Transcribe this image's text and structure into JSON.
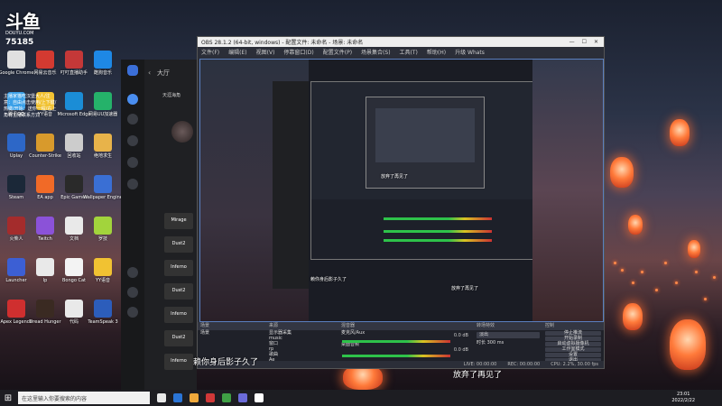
{
  "overlay": {
    "logo": "斗鱼",
    "logo_sub": "DOUYU.COM",
    "room": "75185",
    "notice": "主播家猫吃汉堡大人/注意：自由点击使用/上下键/热键/开始：送你一程/右上角有主播联系方式"
  },
  "desktop": {
    "icons": [
      {
        "label": "Google Chrome",
        "color": "#e0e0e0"
      },
      {
        "label": "网易云音乐",
        "color": "#d33a31"
      },
      {
        "label": "叮叮直播助手",
        "color": "#c43838"
      },
      {
        "label": "酷狗音乐",
        "color": "#1e88e5"
      },
      {
        "label": "腾讯QQ",
        "color": "#3aa0e8"
      },
      {
        "label": "YY语音",
        "color": "#f1c232"
      },
      {
        "label": "Microsoft Edge",
        "color": "#1b8dd6"
      },
      {
        "label": "网易UU加速器",
        "color": "#25b26a"
      },
      {
        "label": "Uplay",
        "color": "#2d67c7"
      },
      {
        "label": "Counter-Strike",
        "color": "#d89a2c"
      },
      {
        "label": "回收站",
        "color": "#cccccc"
      },
      {
        "label": "绝地求生",
        "color": "#e8b34a"
      },
      {
        "label": "Steam",
        "color": "#1b2838"
      },
      {
        "label": "EA app",
        "color": "#f16a27"
      },
      {
        "label": "Epic Games",
        "color": "#2a2a2a"
      },
      {
        "label": "Wallpaper Engine",
        "color": "#3a6fd4"
      },
      {
        "label": "火柴人",
        "color": "#a42c2c"
      },
      {
        "label": "Twitch",
        "color": "#8b52d8"
      },
      {
        "label": "文档",
        "color": "#e9e9e9"
      },
      {
        "label": "罗技",
        "color": "#a2d43c"
      },
      {
        "label": "Launcher",
        "color": "#3c5fd4"
      },
      {
        "label": "lp",
        "color": "#e9e9e9"
      },
      {
        "label": "Bongo Cat",
        "color": "#f3f3f3"
      },
      {
        "label": "YY语音",
        "color": "#f1c232"
      },
      {
        "label": "Apex Legends",
        "color": "#cf2f2f"
      },
      {
        "label": "Dread Hunger",
        "color": "#3a2a22"
      },
      {
        "label": "代码",
        "color": "#e9e9e9"
      },
      {
        "label": "TeamSpeak 3",
        "color": "#2c5dbb"
      }
    ]
  },
  "chat_app": {
    "header": "大厅",
    "lobby": "天涯海角",
    "tiles": [
      "Mirage",
      "Dust2",
      "Inferno",
      "Dust2",
      "Inferno",
      "Dust2",
      "Inferno"
    ]
  },
  "obs": {
    "title": "OBS 28.1.2 (64-bit, windows) - 配置文件: 未命名 - 场景: 未命名",
    "window_controls": [
      "—",
      "☐",
      "✕"
    ],
    "menu": [
      "文件(F)",
      "编辑(E)",
      "视图(V)",
      "停靠窗口(D)",
      "配置文件(P)",
      "场景集合(S)",
      "工具(T)",
      "帮助(H)",
      "升级 Whats"
    ],
    "nested_subtitle": "放弃了再见了",
    "preview_subtitle_left": "赖你身后影子久了",
    "preview_subtitle_right": "放弃了再见了",
    "panels": {
      "scenes": {
        "title": "场景",
        "items": [
          "场景"
        ]
      },
      "sources": {
        "title": "来源",
        "items": [
          "显示器采集",
          "music",
          "窗口",
          "rp",
          "歌曲",
          "Ae"
        ]
      },
      "mixer": {
        "title": "混音器",
        "tracks": [
          {
            "name": "麦克风/Aux",
            "db": "0.0 dB"
          },
          {
            "name": "桌面音频",
            "db": "0.0 dB"
          }
        ]
      },
      "transitions": {
        "title": "转场特效",
        "type": "淡出",
        "duration_label": "时长",
        "duration": "300 ms"
      },
      "controls": {
        "title": "控制",
        "buttons": [
          "停止推流",
          "开始录制",
          "启动虚拟摄像机",
          "工作室模式",
          "设置",
          "退出"
        ]
      }
    },
    "status": {
      "live": "LIVE: 00:00:00",
      "rec": "REC: 00:00:00",
      "cpu": "CPU: 2.2%, 30.00 fps"
    }
  },
  "subtitles": {
    "left": "赖你身后影子久了",
    "right": "放弃了再见了"
  },
  "taskbar": {
    "search_placeholder": "在这里输入你要搜索的内容",
    "time": "23:01",
    "date": "2022/2/22",
    "icon_colors": [
      "#e8e8e8",
      "#2a74d6",
      "#f0a93b",
      "#d03838",
      "#3fa045",
      "#6b6bd9",
      "#ffffff"
    ]
  }
}
